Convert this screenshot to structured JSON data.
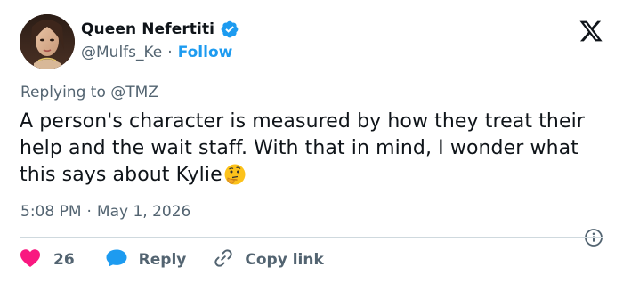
{
  "author": {
    "display_name": "Queen Nefertiti",
    "handle": "@Mulfs_Ke",
    "separator": "·",
    "follow_label": "Follow",
    "verified": true
  },
  "platform": {
    "logo": "x-logo-icon"
  },
  "reply_context": {
    "prefix": "Replying to",
    "mention": "@TMZ"
  },
  "tweet": {
    "text": "A person's character is measured by how they treat their help and the wait staff. With that in mind, I wonder what this says about Kylie",
    "emoji": "thinking-face-emoji",
    "time": "5:08 PM",
    "separator": "·",
    "date": "May 1, 2026"
  },
  "actions": {
    "like_count": "26",
    "reply_label": "Reply",
    "copy_label": "Copy link"
  },
  "colors": {
    "text": "#0f1419",
    "muted": "#536471",
    "accent": "#1d9bf0",
    "like": "#f91880",
    "divider": "#cfd9de"
  }
}
